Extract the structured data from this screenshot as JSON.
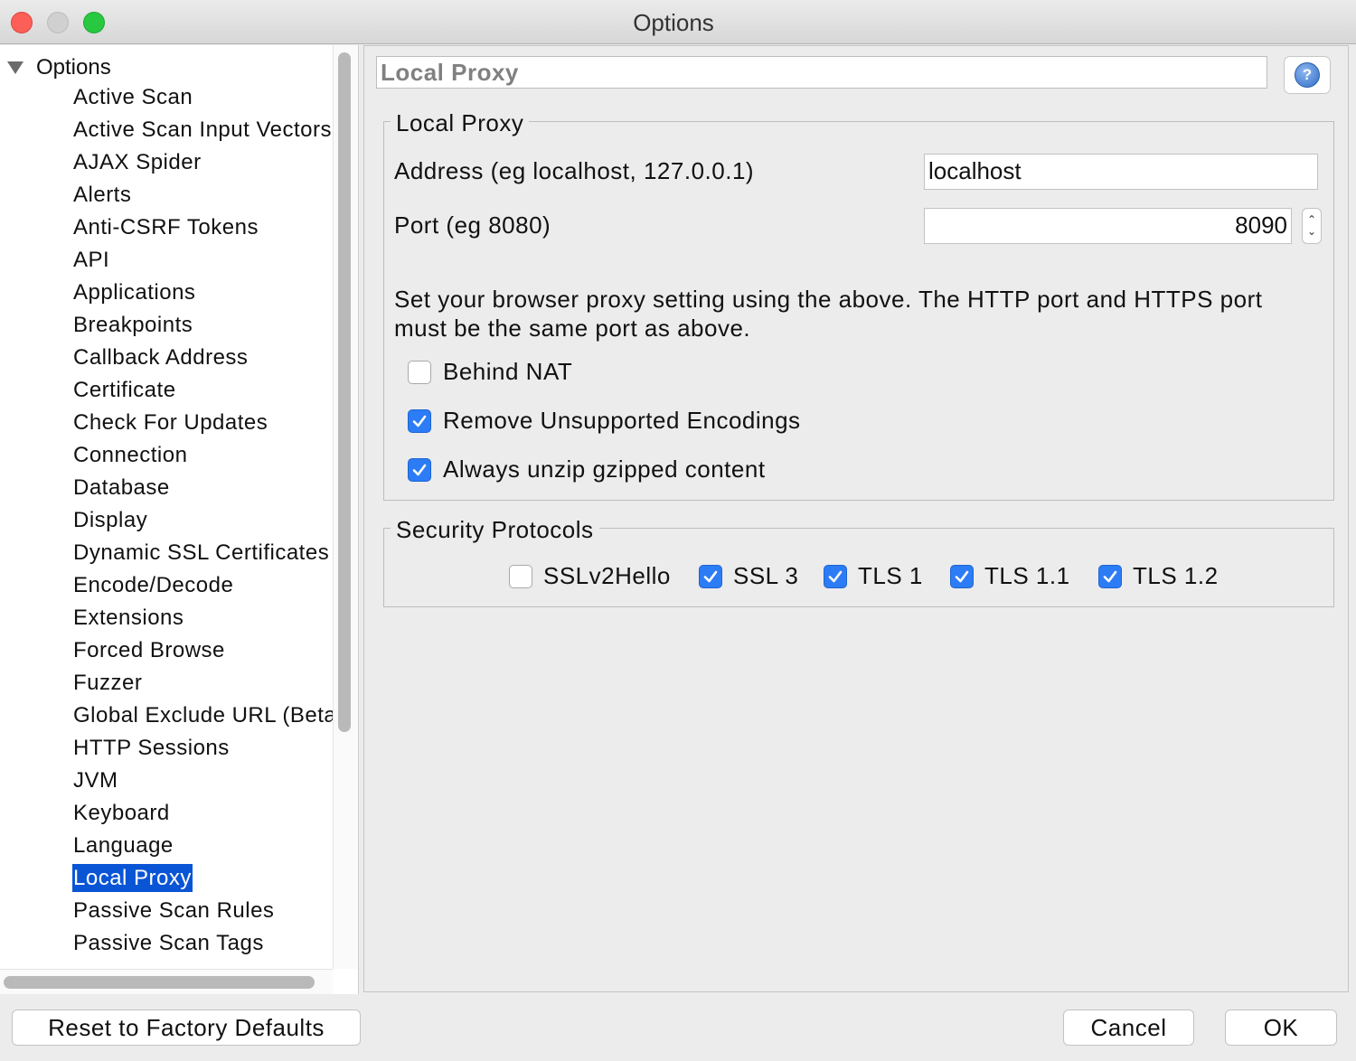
{
  "window": {
    "title": "Options"
  },
  "sidebar": {
    "root_label": "Options",
    "items": [
      {
        "label": "Active Scan"
      },
      {
        "label": "Active Scan Input Vectors"
      },
      {
        "label": "AJAX Spider"
      },
      {
        "label": "Alerts"
      },
      {
        "label": "Anti-CSRF Tokens"
      },
      {
        "label": "API"
      },
      {
        "label": "Applications"
      },
      {
        "label": "Breakpoints"
      },
      {
        "label": "Callback Address"
      },
      {
        "label": "Certificate"
      },
      {
        "label": "Check For Updates"
      },
      {
        "label": "Connection"
      },
      {
        "label": "Database"
      },
      {
        "label": "Display"
      },
      {
        "label": "Dynamic SSL Certificates"
      },
      {
        "label": "Encode/Decode"
      },
      {
        "label": "Extensions"
      },
      {
        "label": "Forced Browse"
      },
      {
        "label": "Fuzzer"
      },
      {
        "label": "Global Exclude URL (Beta"
      },
      {
        "label": "HTTP Sessions"
      },
      {
        "label": "JVM"
      },
      {
        "label": "Keyboard"
      },
      {
        "label": "Language"
      },
      {
        "label": "Local Proxy",
        "selected": true
      },
      {
        "label": "Passive Scan Rules"
      },
      {
        "label": "Passive Scan Tags"
      }
    ]
  },
  "panel": {
    "title": "Local Proxy",
    "help_icon": "help-icon",
    "local_proxy": {
      "legend": "Local Proxy",
      "address_label": "Address (eg localhost, 127.0.0.1)",
      "address_value": "localhost",
      "port_label": "Port (eg 8080)",
      "port_value": "8090",
      "info_line1": "Set your browser proxy setting using the above. The HTTP port and HTTPS port",
      "info_line2": "must be the same port as above.",
      "behind_nat": {
        "label": "Behind NAT",
        "checked": false
      },
      "remove_encodings": {
        "label": "Remove Unsupported Encodings",
        "checked": true
      },
      "unzip_gzip": {
        "label": "Always unzip gzipped content",
        "checked": true
      }
    },
    "security_protocols": {
      "legend": "Security Protocols",
      "protocols": [
        {
          "label": "SSLv2Hello",
          "checked": false
        },
        {
          "label": "SSL 3",
          "checked": true
        },
        {
          "label": "TLS 1",
          "checked": true
        },
        {
          "label": "TLS 1.1",
          "checked": true
        },
        {
          "label": "TLS 1.2",
          "checked": true
        }
      ]
    }
  },
  "footer": {
    "reset_label": "Reset to Factory Defaults",
    "cancel_label": "Cancel",
    "ok_label": "OK"
  },
  "colors": {
    "selection": "#0a55d6",
    "checkbox_on": "#2c7cf6"
  }
}
